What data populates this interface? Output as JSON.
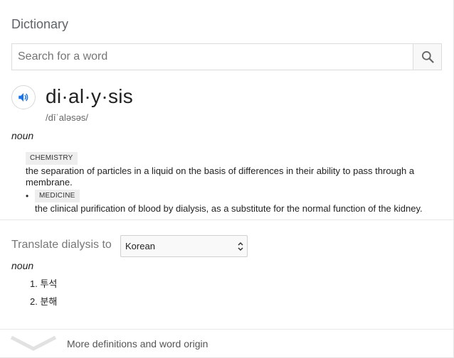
{
  "widget": {
    "title": "Dictionary"
  },
  "search": {
    "placeholder": "Search for a word",
    "value": ""
  },
  "entry": {
    "headword": "di·al·y·sis",
    "phonetic": "/dīˈaləsəs/",
    "part_of_speech": "noun",
    "definitions": [
      {
        "label": "CHEMISTRY",
        "text": "the separation of particles in a liquid on the basis of differences in their ability to pass through a membrane."
      },
      {
        "label": "MEDICINE",
        "text": "the clinical purification of blood by dialysis, as a substitute for the normal function of the kidney."
      }
    ]
  },
  "translate": {
    "label": "Translate dialysis to",
    "selected_language": "Korean",
    "part_of_speech": "noun",
    "results": [
      {
        "num": "1.",
        "text": "투석"
      },
      {
        "num": "2.",
        "text": "분해"
      }
    ]
  },
  "footer": {
    "more_link": "More definitions and word origin"
  },
  "colors": {
    "accent_blue": "#1a73e8",
    "tag_bg": "#eeeeee",
    "divider": "#e8e8e8"
  },
  "icons": {
    "search": "search-icon",
    "speaker": "speaker-icon",
    "chevron": "chevron-down-icon",
    "select": "select-arrows-icon"
  }
}
